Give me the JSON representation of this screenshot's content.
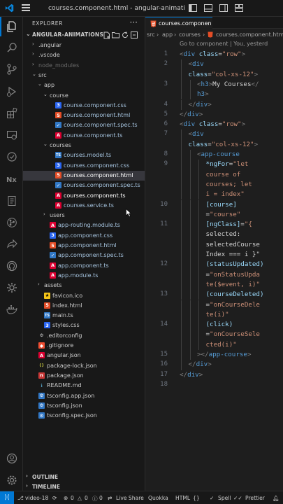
{
  "titlebar": {
    "title": "courses.component.html - angular-animations - Visual Studio Code",
    "icons": [
      "layout-sidebar-icon",
      "layout-panel-icon",
      "layout-sidebar-right-icon",
      "customize-layout-icon"
    ]
  },
  "activity_bar": {
    "items": [
      "explorer-icon",
      "search-icon",
      "source-control-icon",
      "run-debug-icon",
      "extensions-icon",
      "remote-explorer-icon",
      "testing-icon",
      "nx-console-icon",
      "bookmarks-icon",
      "git-graph-icon",
      "live-share-icon",
      "github-icon",
      "angular-icon",
      "docker-icon"
    ],
    "bottom": [
      "account-icon",
      "manage-gear-icon"
    ]
  },
  "sidebar": {
    "title": "EXPLORER",
    "more": "···",
    "project": "ANGULAR-ANIMATIONS",
    "outline": "OUTLINE",
    "timeline": "TIMELINE",
    "tree": [
      {
        "name": ".angular",
        "type": "folder",
        "level": 1,
        "open": false,
        "color": "#cccccc"
      },
      {
        "name": ".vscode",
        "type": "folder",
        "level": 1,
        "open": false,
        "color": "#cccccc"
      },
      {
        "name": "node_modules",
        "type": "folder",
        "level": 1,
        "open": false,
        "color": "#6b6b6b"
      },
      {
        "name": "src",
        "type": "folder",
        "level": 1,
        "open": true,
        "color": "#cccccc"
      },
      {
        "name": "app",
        "type": "folder",
        "level": 2,
        "open": true,
        "color": "#cccccc"
      },
      {
        "name": "course",
        "type": "folder",
        "level": 3,
        "open": true,
        "color": "#cccccc"
      },
      {
        "name": "course.component.css",
        "type": "css",
        "level": 4,
        "color": "#a6c4df"
      },
      {
        "name": "course.component.html",
        "type": "html",
        "level": 4,
        "color": "#a6c4df"
      },
      {
        "name": "course.component.spec.ts",
        "type": "spec",
        "level": 4,
        "color": "#a6c4df"
      },
      {
        "name": "course.component.ts",
        "type": "ng",
        "level": 4,
        "color": "#a6c4df"
      },
      {
        "name": "courses",
        "type": "folder",
        "level": 3,
        "open": true,
        "color": "#cccccc"
      },
      {
        "name": "courses.model.ts",
        "type": "ts",
        "level": 4,
        "color": "#a6c4df"
      },
      {
        "name": "courses.component.css",
        "type": "css",
        "level": 4,
        "color": "#a6c4df"
      },
      {
        "name": "courses.component.html",
        "type": "html",
        "level": 4,
        "color": "#ffffff",
        "selected": true
      },
      {
        "name": "courses.component.spec.ts",
        "type": "spec",
        "level": 4,
        "color": "#a6c4df"
      },
      {
        "name": "courses.component.ts",
        "type": "ng",
        "level": 4,
        "color": "#ffffff"
      },
      {
        "name": "courses.service.ts",
        "type": "ng",
        "level": 4,
        "color": "#a6c4df"
      },
      {
        "name": "users",
        "type": "folder",
        "level": 3,
        "open": false,
        "color": "#cccccc"
      },
      {
        "name": "app-routing.module.ts",
        "type": "ng",
        "level": 3,
        "color": "#a6c4df"
      },
      {
        "name": "app.component.css",
        "type": "css",
        "level": 3,
        "color": "#a6c4df"
      },
      {
        "name": "app.component.html",
        "type": "html",
        "level": 3,
        "color": "#a6c4df"
      },
      {
        "name": "app.component.spec.ts",
        "type": "spec",
        "level": 3,
        "color": "#a6c4df"
      },
      {
        "name": "app.component.ts",
        "type": "ng",
        "level": 3,
        "color": "#a6c4df"
      },
      {
        "name": "app.module.ts",
        "type": "ng",
        "level": 3,
        "color": "#a6c4df"
      },
      {
        "name": "assets",
        "type": "folder",
        "level": 2,
        "open": false,
        "color": "#cccccc"
      },
      {
        "name": "favicon.ico",
        "type": "ico",
        "level": 2,
        "color": "#cccccc"
      },
      {
        "name": "index.html",
        "type": "html",
        "level": 2,
        "color": "#cccccc"
      },
      {
        "name": "main.ts",
        "type": "ts",
        "level": 2,
        "color": "#cccccc"
      },
      {
        "name": "styles.css",
        "type": "css",
        "level": 2,
        "color": "#cccccc"
      },
      {
        "name": ".editorconfig",
        "type": "gear",
        "level": 1,
        "color": "#cccccc"
      },
      {
        "name": ".gitignore",
        "type": "git",
        "level": 1,
        "color": "#cccccc"
      },
      {
        "name": "angular.json",
        "type": "ng",
        "level": 1,
        "color": "#cccccc"
      },
      {
        "name": "package-lock.json",
        "type": "json",
        "level": 1,
        "color": "#cccccc"
      },
      {
        "name": "package.json",
        "type": "npm",
        "level": 1,
        "color": "#cccccc"
      },
      {
        "name": "README.md",
        "type": "md",
        "level": 1,
        "color": "#cccccc"
      },
      {
        "name": "tsconfig.app.json",
        "type": "tsjson",
        "level": 1,
        "color": "#cccccc"
      },
      {
        "name": "tsconfig.json",
        "type": "tsjson",
        "level": 1,
        "color": "#cccccc"
      },
      {
        "name": "tsconfig.spec.json",
        "type": "tsjson",
        "level": 1,
        "color": "#cccccc"
      }
    ]
  },
  "editor": {
    "tab_label": "courses.componen",
    "breadcrumb": [
      "src",
      "app",
      "courses",
      "courses.component.html"
    ],
    "codelens": "Go to component | You, yesterd",
    "lines": [
      {
        "n": "1",
        "segs": [
          [
            "brk",
            "<"
          ],
          [
            "tag",
            "div "
          ],
          [
            "attr",
            "class"
          ],
          [
            "plain",
            "="
          ],
          [
            "str",
            "\"row\""
          ],
          [
            "brk",
            ">"
          ]
        ],
        "indent": 0
      },
      {
        "n": "2",
        "segs": [
          [
            "brk",
            "<"
          ],
          [
            "tag",
            "div"
          ]
        ],
        "indent": 1
      },
      {
        "n": "",
        "segs": [
          [
            "attr",
            "class"
          ],
          [
            "plain",
            "="
          ],
          [
            "str",
            "\"col-xs-12\""
          ],
          [
            "brk",
            ">"
          ]
        ],
        "indent": 1
      },
      {
        "n": "3",
        "segs": [
          [
            "brk",
            "<"
          ],
          [
            "tag",
            "h3"
          ],
          [
            "brk",
            ">"
          ],
          [
            "plain",
            "My Courses"
          ],
          [
            "brk",
            "</"
          ]
        ],
        "indent": 2
      },
      {
        "n": "",
        "segs": [
          [
            "tag",
            "h3"
          ],
          [
            "brk",
            ">"
          ]
        ],
        "indent": 2
      },
      {
        "n": "4",
        "segs": [
          [
            "brk",
            "</"
          ],
          [
            "tag",
            "div"
          ],
          [
            "brk",
            ">"
          ]
        ],
        "indent": 1
      },
      {
        "n": "5",
        "segs": [
          [
            "brk",
            "</"
          ],
          [
            "tag",
            "div"
          ],
          [
            "brk",
            ">"
          ]
        ],
        "indent": 0
      },
      {
        "n": "6",
        "segs": [
          [
            "brk",
            "<"
          ],
          [
            "tag",
            "div "
          ],
          [
            "attr",
            "class"
          ],
          [
            "plain",
            "="
          ],
          [
            "str",
            "\"row\""
          ],
          [
            "brk",
            ">"
          ]
        ],
        "indent": 0
      },
      {
        "n": "7",
        "segs": [
          [
            "brk",
            "<"
          ],
          [
            "tag",
            "div"
          ]
        ],
        "indent": 1
      },
      {
        "n": "",
        "segs": [
          [
            "attr",
            "class"
          ],
          [
            "plain",
            "="
          ],
          [
            "str",
            "\"col-xs-12\""
          ],
          [
            "brk",
            ">"
          ]
        ],
        "indent": 1
      },
      {
        "n": "8",
        "segs": [
          [
            "brk",
            "<"
          ],
          [
            "tag",
            "app-course"
          ]
        ],
        "indent": 2
      },
      {
        "n": "9",
        "segs": [
          [
            "attr",
            "*ngFor"
          ],
          [
            "plain",
            "="
          ],
          [
            "str",
            "\"let"
          ]
        ],
        "indent": 3
      },
      {
        "n": "",
        "segs": [
          [
            "str",
            "course of"
          ]
        ],
        "indent": 3
      },
      {
        "n": "",
        "segs": [
          [
            "str",
            "courses; let"
          ]
        ],
        "indent": 3
      },
      {
        "n": "",
        "segs": [
          [
            "str",
            "i = index\""
          ]
        ],
        "indent": 3
      },
      {
        "n": "10",
        "segs": [
          [
            "attr",
            "[course]"
          ]
        ],
        "indent": 3
      },
      {
        "n": "",
        "segs": [
          [
            "plain",
            "="
          ],
          [
            "str",
            "\"course\""
          ]
        ],
        "indent": 3
      },
      {
        "n": "11",
        "segs": [
          [
            "attr",
            "[ngClass]"
          ],
          [
            "plain",
            "="
          ],
          [
            "str",
            "\"{"
          ]
        ],
        "indent": 3
      },
      {
        "n": "",
        "segs": [
          [
            "plain",
            "selected:"
          ]
        ],
        "indent": 3
      },
      {
        "n": "",
        "segs": [
          [
            "plain",
            "selectedCourse"
          ]
        ],
        "indent": 3
      },
      {
        "n": "",
        "segs": [
          [
            "plain",
            "Index === i }\""
          ]
        ],
        "indent": 3
      },
      {
        "n": "12",
        "segs": [
          [
            "attr",
            "(statusUpdated)"
          ]
        ],
        "indent": 3
      },
      {
        "n": "",
        "segs": [
          [
            "plain",
            "="
          ],
          [
            "str",
            "\"onStatusUpda"
          ]
        ],
        "indent": 3
      },
      {
        "n": "",
        "segs": [
          [
            "str",
            "te($event, i)\""
          ]
        ],
        "indent": 3
      },
      {
        "n": "13",
        "segs": [
          [
            "attr",
            "(courseDeleted)"
          ]
        ],
        "indent": 3
      },
      {
        "n": "",
        "segs": [
          [
            "plain",
            "="
          ],
          [
            "str",
            "\"onCourseDele"
          ]
        ],
        "indent": 3
      },
      {
        "n": "",
        "segs": [
          [
            "str",
            "te(i)\""
          ]
        ],
        "indent": 3
      },
      {
        "n": "14",
        "segs": [
          [
            "attr",
            "(click)"
          ]
        ],
        "indent": 3
      },
      {
        "n": "",
        "segs": [
          [
            "plain",
            "="
          ],
          [
            "str",
            "\"onCourseSele"
          ]
        ],
        "indent": 3
      },
      {
        "n": "",
        "segs": [
          [
            "str",
            "cted(i)\""
          ]
        ],
        "indent": 3
      },
      {
        "n": "15",
        "segs": [
          [
            "brk",
            "></"
          ],
          [
            "tag",
            "app-course"
          ],
          [
            "brk",
            ">"
          ]
        ],
        "indent": 2
      },
      {
        "n": "16",
        "segs": [
          [
            "brk",
            "</"
          ],
          [
            "tag",
            "div"
          ],
          [
            "brk",
            ">"
          ]
        ],
        "indent": 1
      },
      {
        "n": "17",
        "segs": [
          [
            "brk",
            "</"
          ],
          [
            "tag",
            "div"
          ],
          [
            "brk",
            ">"
          ]
        ],
        "indent": 0
      },
      {
        "n": "18",
        "segs": [],
        "indent": 0
      }
    ]
  },
  "status": {
    "branch": "video-18",
    "errors": "0",
    "warnings": "0",
    "info": "0",
    "live_share": "Live Share",
    "quokka": "Quokka",
    "language": "HTML",
    "spell": "Spell",
    "prettier": "Prettier",
    "accent": "#0078d4"
  }
}
